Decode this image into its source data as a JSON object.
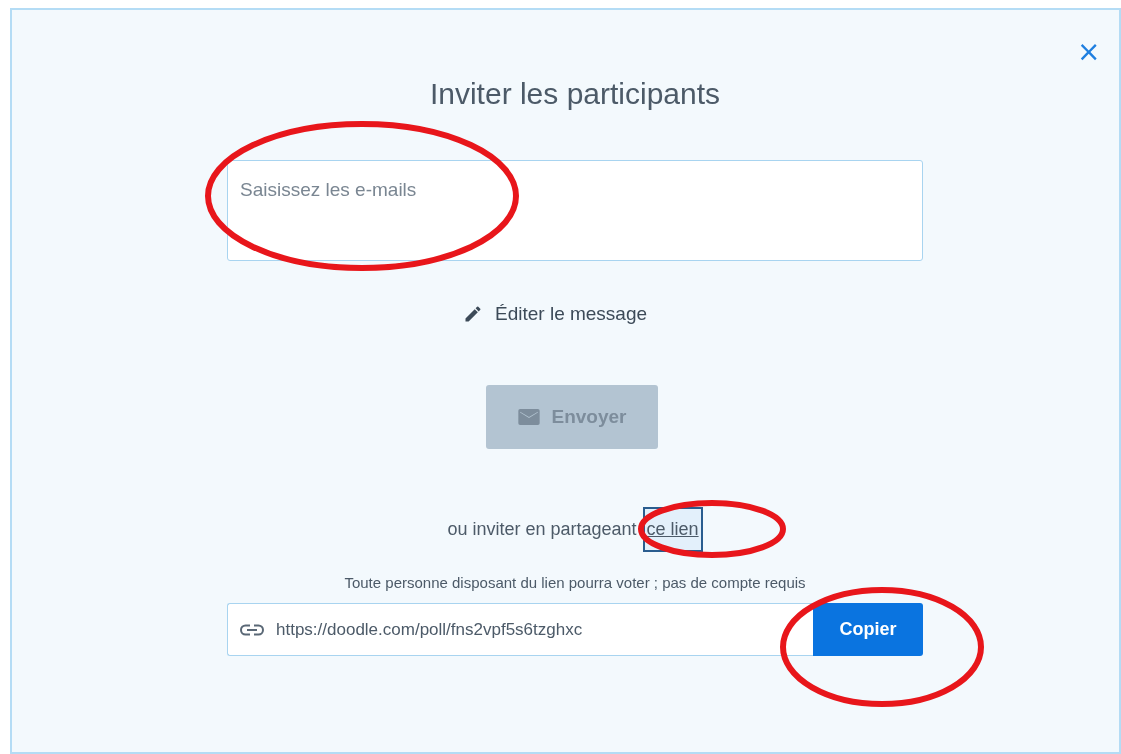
{
  "dialog": {
    "title": "Inviter les participants",
    "close": "×"
  },
  "email_field": {
    "placeholder": "Saisissez les e-mails",
    "circled": true
  },
  "edit_message": {
    "label": "Éditer le message"
  },
  "send_button": {
    "label": "Envoyer",
    "disabled": true
  },
  "share": {
    "text": "ou inviter en partageant",
    "link": "ce lien",
    "focused": true,
    "circled": true
  },
  "hint": "Toute personne disposant du lien pourra voter ; pas de compte requis",
  "link_field": {
    "value": "https://doodle.com/poll/fns2vpf5s6tzghxc"
  },
  "copy_button": {
    "label": "Copier",
    "circled": true
  }
}
